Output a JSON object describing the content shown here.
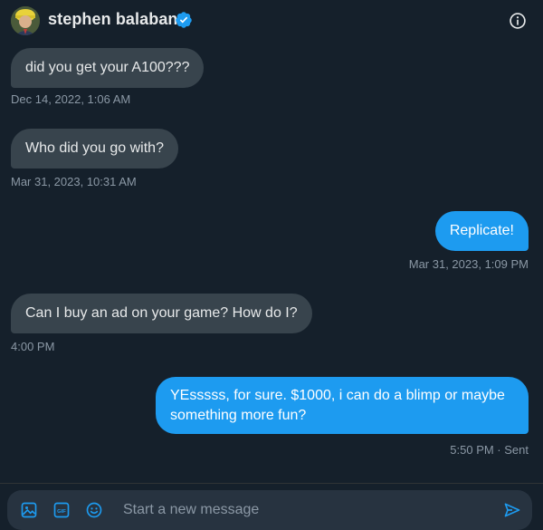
{
  "header": {
    "name": "stephen balaban",
    "verified_icon": "verified-badge-icon",
    "info_icon": "info-icon"
  },
  "messages": [
    {
      "direction": "incoming",
      "text": "did you get your A100???",
      "timestamp": "Dec 14, 2022, 1:06 AM"
    },
    {
      "direction": "incoming",
      "text": "Who did you go with?",
      "timestamp": "Mar 31, 2023, 10:31 AM"
    },
    {
      "direction": "outgoing",
      "text": "Replicate!",
      "timestamp": "Mar 31, 2023, 1:09 PM"
    },
    {
      "direction": "incoming",
      "text": "Can I buy an ad on your game? How do I?",
      "timestamp": "4:00 PM"
    },
    {
      "direction": "outgoing",
      "text_line1": "YEsssss, for sure. $1000, i can do a blimp or maybe",
      "text_line2": "something more fun?",
      "timestamp": "5:50 PM · Sent"
    }
  ],
  "composer": {
    "placeholder": "Start a new message",
    "icons": [
      "image-icon",
      "gif-icon",
      "emoji-icon",
      "send-icon"
    ]
  },
  "colors": {
    "background": "#15202b",
    "incoming_bubble": "#38444d",
    "outgoing_bubble": "#1d9bf0",
    "timestamp": "#8b98a5",
    "accent": "#1d9bf0"
  }
}
